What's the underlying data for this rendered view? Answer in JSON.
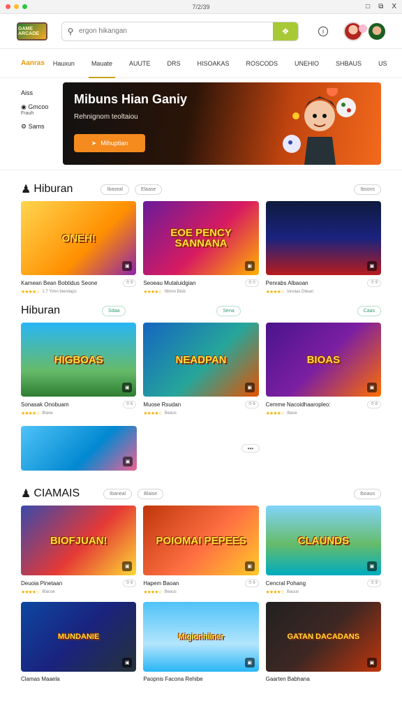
{
  "window": {
    "title": "7/2/39",
    "controls": [
      "□",
      "⧉",
      "X"
    ]
  },
  "header": {
    "logo_text": "GAME ARCADE",
    "search_placeholder": "ergon hikangan",
    "search_button_icon": "controller-icon",
    "info_icon": "i"
  },
  "nav": {
    "brand": "Aanras",
    "tabs": [
      "Hauxun",
      "Mauate",
      "AUUTE",
      "DRS",
      "HISOAKAS",
      "ROSCODS",
      "UNEHIO",
      "SHBAUS",
      "US"
    ],
    "active_index": 1
  },
  "sidebar": {
    "items": [
      {
        "label": "Aiss",
        "sub": ""
      },
      {
        "label": "Gmcoo",
        "sub": "Frauh"
      },
      {
        "label": "Sams",
        "sub": ""
      }
    ]
  },
  "hero": {
    "title": "Mibuns Hian Ganiy",
    "subtitle": "Rehnignom teoltaiou",
    "cta": "Mihuptian",
    "cta_icon": "arrow-icon"
  },
  "sections": [
    {
      "title": "Hiburan",
      "has_icon": true,
      "pills": [
        "Ibaseal",
        "Elaase"
      ],
      "right_pill": "Ibsons",
      "cards": [
        {
          "thumb_title": "ONEH!",
          "name": "Kamean Bean Bobtidus Seone",
          "count": "⏱ 9",
          "sub": "1.7 Yimn biendaps"
        },
        {
          "thumb_title": "EOE PENCY SANNANA",
          "name": "Seoeau Mutaluidgian",
          "count": "⏱ 0",
          "sub": "Iltmnn Biob"
        },
        {
          "thumb_title": "",
          "name": "Penrabs Albaoan",
          "count": "⏱ 9",
          "sub": "Ionolas Dliean"
        }
      ]
    },
    {
      "title": "Hiburan",
      "has_icon": false,
      "pills": [
        "Sdaa"
      ],
      "mid_pill": "Sena",
      "right_pill": "Caas",
      "cards": [
        {
          "thumb_title": "HIGBOAS",
          "name": "Sonasak Onobuam",
          "count": "⏱ 6",
          "sub": "Blaoe"
        },
        {
          "thumb_title": "NEADPAN",
          "name": "Muose Rsudan",
          "count": "⏱ 6",
          "sub": "Beaus"
        },
        {
          "thumb_title": "BIOAS",
          "name": "Cemme Nacoidhaaropleo:",
          "count": "⏱ 8",
          "sub": "Ibase"
        }
      ],
      "extra_card": {
        "thumb_title": ""
      },
      "more": "•••"
    },
    {
      "title": "CIAMAIS",
      "has_icon": true,
      "pills": [
        "Ibaneal",
        "Blaise"
      ],
      "right_pill": "Iboaus",
      "cards": [
        {
          "thumb_title": "BIOFJUAN!",
          "name": "Deuoia Pinetaan",
          "count": "⏱ 6",
          "sub": "Blacoe"
        },
        {
          "thumb_title": "POIOMAI PEPEES",
          "name": "Hapem Baoan",
          "count": "⏱ 6",
          "sub": "Beaus"
        },
        {
          "thumb_title": "CLAUNDS",
          "name": "Cencral Pohang",
          "count": "⏱ 9",
          "sub": "Bauus"
        }
      ]
    },
    {
      "cards": [
        {
          "thumb_title": "MUNDANIE",
          "name": "Clamas Maaela"
        },
        {
          "thumb_title": "Migionhiiner",
          "name": "Paopnis Facona Rehibe"
        },
        {
          "thumb_title": "GATAN DACADANS",
          "name": "Gaarten Babhana"
        }
      ]
    }
  ],
  "colors": {
    "accent": "#e69a12",
    "search_button": "#a8c936",
    "star": "#f0b100",
    "cta": "#f58a1f"
  }
}
